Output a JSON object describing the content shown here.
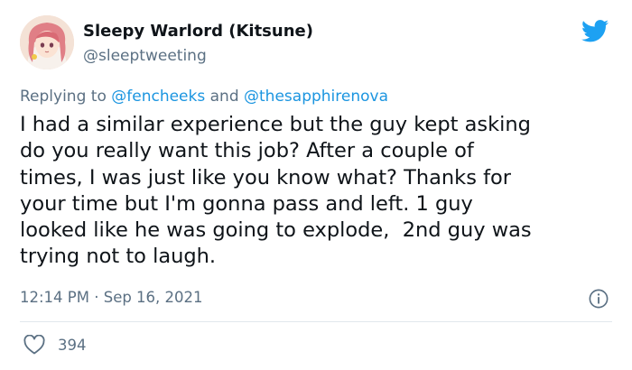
{
  "author": {
    "name": "Sleepy Warlord (Kitsune)",
    "handle": "@sleeptweeting"
  },
  "reply": {
    "prefix": "Replying to ",
    "mention_1": "@fencheeks",
    "joiner": " and ",
    "mention_2": "@thesapphirenova"
  },
  "tweet": {
    "text": "I had a similar experience but the guy kept asking\ndo you really want this job? After a couple of\ntimes, I was just like you know what? Thanks for\nyour time but I'm gonna pass and left. 1 guy\nlooked like he was going to explode,  2nd guy was\ntrying not to laugh.",
    "timestamp": "12:14 PM · Sep 16, 2021",
    "likes": "394"
  },
  "icons": {
    "brand": "twitter-bird-icon",
    "info": "info-icon",
    "like": "heart-icon"
  },
  "colors": {
    "brand": "#1da1f2",
    "mention": "#1b95e0",
    "secondary_text": "#5b7083"
  }
}
